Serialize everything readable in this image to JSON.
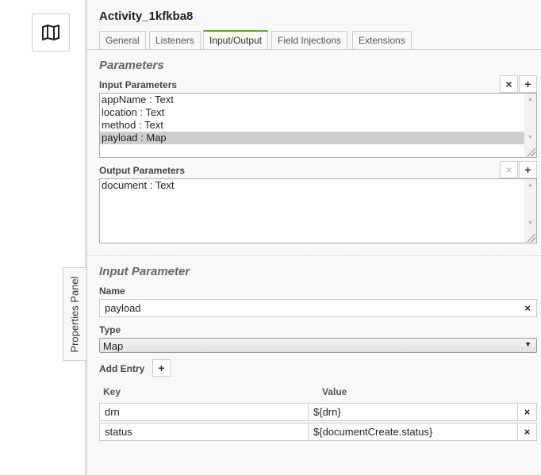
{
  "canvas": {
    "map_icon": "map-icon",
    "properties_panel_label": "Properties Panel"
  },
  "panel": {
    "title": "Activity_1kfkba8",
    "tabs": [
      {
        "label": "General",
        "active": false
      },
      {
        "label": "Listeners",
        "active": false
      },
      {
        "label": "Input/Output",
        "active": true
      },
      {
        "label": "Field Injections",
        "active": false
      },
      {
        "label": "Extensions",
        "active": false
      }
    ],
    "accent_color": "#52b415"
  },
  "parameters": {
    "section_title": "Parameters",
    "input_label": "Input Parameters",
    "input_items": [
      "appName : Text",
      "location : Text",
      "method : Text",
      "payload : Map"
    ],
    "input_selected": "payload : Map",
    "output_label": "Output Parameters",
    "output_items": [
      "document : Text"
    ],
    "remove_glyph": "×",
    "add_glyph": "+"
  },
  "input_parameter": {
    "section_title": "Input Parameter",
    "name_label": "Name",
    "name_value": "payload",
    "clear_glyph": "×",
    "type_label": "Type",
    "type_value": "Map",
    "type_arrow": "▼",
    "add_entry_label": "Add Entry",
    "add_entry_glyph": "+",
    "key_header": "Key",
    "value_header": "Value",
    "entries": [
      {
        "key": "drn",
        "value": "${drn}"
      },
      {
        "key": "status",
        "value": "${documentCreate.status}"
      }
    ],
    "row_remove_glyph": "×"
  }
}
